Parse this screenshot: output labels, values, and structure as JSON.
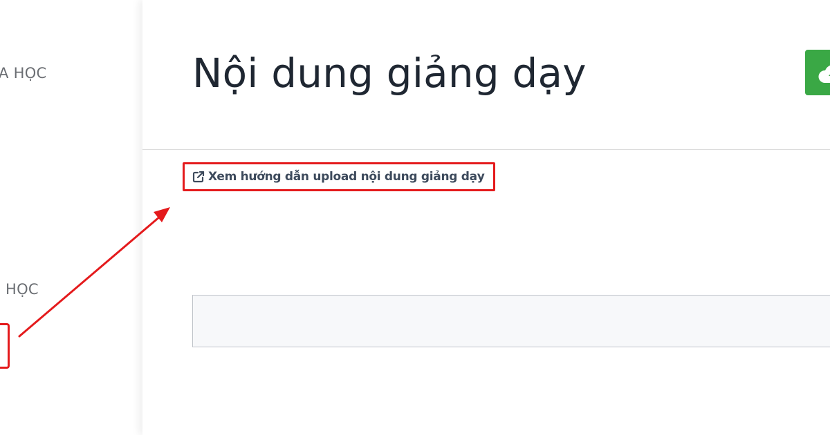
{
  "sidebar": {
    "items": [
      {
        "label": "A HỌC"
      },
      {
        "label": "HỌC"
      }
    ]
  },
  "main": {
    "title": "Nội dung giảng dạy",
    "guide_link_label": "Xem hướng dẫn upload nội dung giảng dạy",
    "upload_button_icon": "cloud-upload-icon",
    "guide_link_icon": "external-link-icon"
  },
  "colors": {
    "highlight": "#e41a1c",
    "upload_button": "#3aa845",
    "title_text": "#1f2732",
    "link_text": "#3d4a5c"
  }
}
